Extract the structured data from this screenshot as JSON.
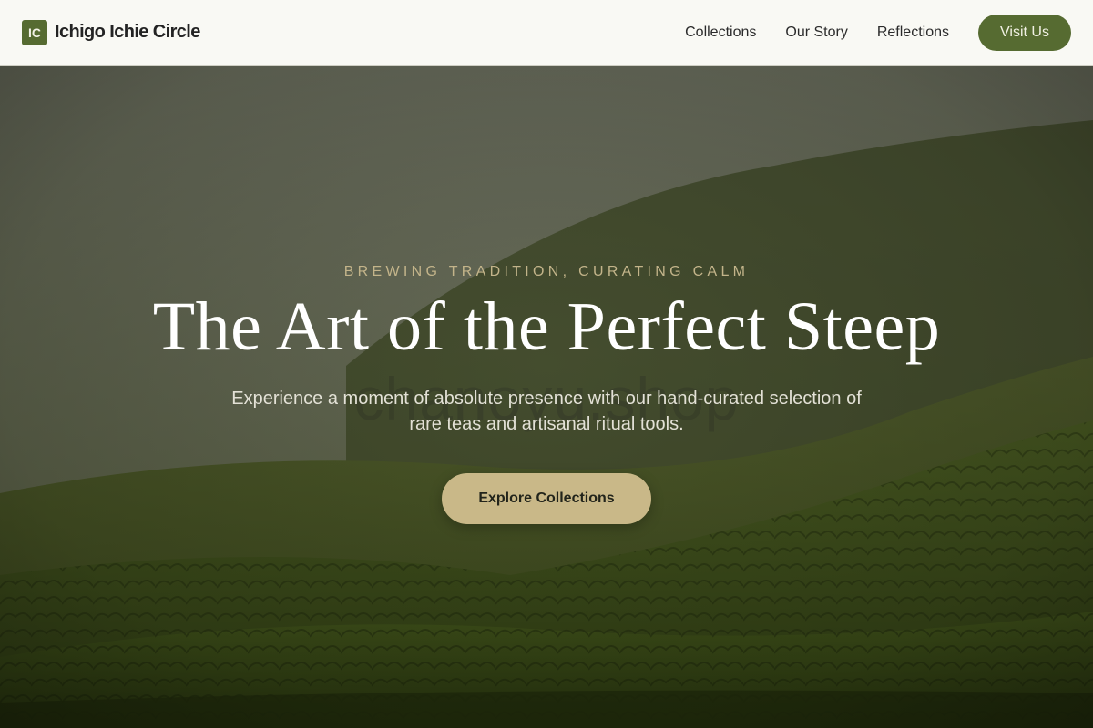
{
  "brand": {
    "mark": "IC",
    "name": "Ichigo Ichie Circle"
  },
  "nav": {
    "links": [
      "Collections",
      "Our Story",
      "Reflections"
    ],
    "cta_label": "Visit Us"
  },
  "hero": {
    "eyebrow": "BREWING TRADITION, CURATING CALM",
    "title": "The Art of the Perfect Steep",
    "subtitle": "Experience a moment of absolute presence with our hand-curated selection of rare teas and artisanal ritual tools.",
    "watermark": "chanoyu.shop",
    "cta_label": "Explore Collections",
    "image": "misty tea plantation hills"
  },
  "colors": {
    "brand_green": "#566b31",
    "cta_beige": "#c9b888",
    "eyebrow_gold": "#c3b48a",
    "nav_bg": "#f9f9f4"
  }
}
